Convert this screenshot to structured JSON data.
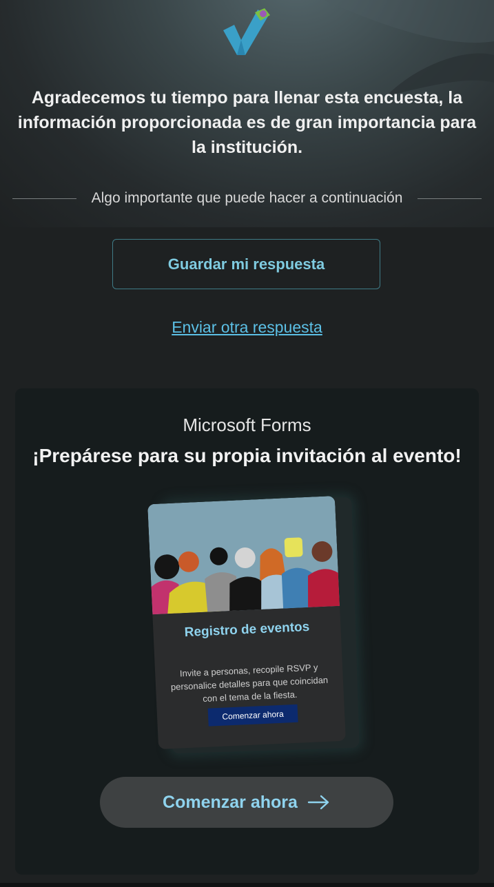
{
  "thanks": {
    "line1": "Agradecemos tu tiempo para llenar esta encuesta, la",
    "line2": "información proporcionada es de gran importancia para",
    "line3": "la institución."
  },
  "divider": {
    "label": "Algo importante que puede hacer a continuación"
  },
  "actions": {
    "save_label": "Guardar mi respuesta",
    "another_label": "Enviar otra respuesta"
  },
  "promo": {
    "brand": "Microsoft Forms",
    "title": "¡Prepárese para su propia invitación al evento!",
    "preview": {
      "title": "Registro de eventos",
      "description": "Invite a personas, recopile RSVP y personalice detalles para que coincidan con el tema de la fiesta.",
      "button_label": "Comenzar ahora"
    },
    "start_label": "Comenzar ahora",
    "start_icon": "arrow-right-icon"
  },
  "colors": {
    "accent": "#8fd3ee",
    "link": "#5cc0e6",
    "background": "#1e2122",
    "card": "#161c1d",
    "preview_button": "#0c2a6e"
  }
}
